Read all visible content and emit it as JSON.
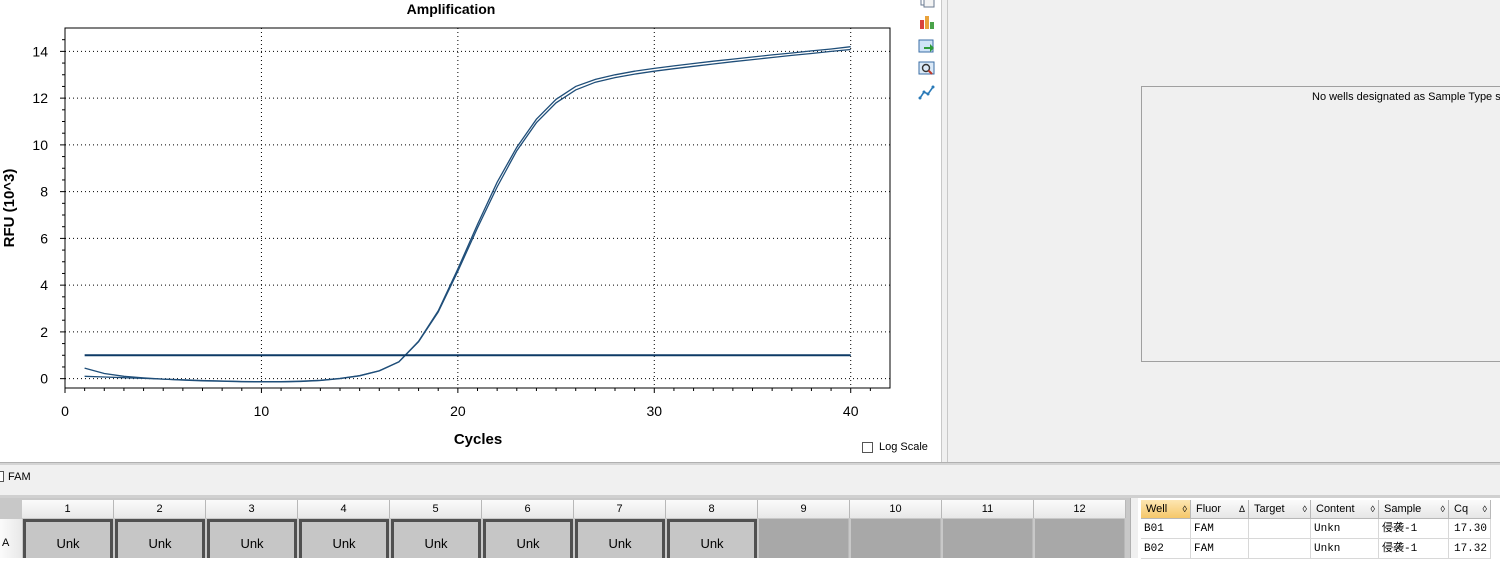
{
  "chart_data": {
    "type": "line",
    "title": "Amplification",
    "xlabel": "Cycles",
    "ylabel": "RFU (10^3)",
    "xlim": [
      0,
      42
    ],
    "ylim": [
      -0.4,
      15
    ],
    "xticks": [
      0,
      10,
      20,
      30,
      40
    ],
    "yticks": [
      0,
      2,
      4,
      6,
      8,
      10,
      12,
      14
    ],
    "grid": true,
    "threshold": 1.0,
    "x": [
      1,
      2,
      3,
      4,
      5,
      6,
      7,
      8,
      9,
      10,
      11,
      12,
      13,
      14,
      15,
      16,
      17,
      18,
      19,
      20,
      21,
      22,
      23,
      24,
      25,
      26,
      27,
      28,
      29,
      30,
      31,
      32,
      33,
      34,
      35,
      36,
      37,
      38,
      39,
      40
    ],
    "series": [
      {
        "values": [
          0.45,
          0.22,
          0.1,
          0.03,
          -0.02,
          -0.06,
          -0.09,
          -0.11,
          -0.13,
          -0.14,
          -0.14,
          -0.12,
          -0.08,
          0.0,
          0.12,
          0.33,
          0.72,
          1.6,
          2.9,
          4.7,
          6.6,
          8.4,
          9.9,
          11.1,
          11.95,
          12.5,
          12.8,
          13.0,
          13.15,
          13.27,
          13.38,
          13.48,
          13.58,
          13.67,
          13.76,
          13.85,
          13.93,
          14.02,
          14.1,
          14.2
        ]
      },
      {
        "values": [
          0.1,
          0.07,
          0.04,
          0.01,
          -0.02,
          -0.05,
          -0.08,
          -0.1,
          -0.12,
          -0.13,
          -0.13,
          -0.11,
          -0.07,
          0.01,
          0.13,
          0.34,
          0.72,
          1.58,
          2.85,
          4.6,
          6.45,
          8.2,
          9.75,
          10.95,
          11.8,
          12.35,
          12.68,
          12.88,
          13.03,
          13.15,
          13.26,
          13.36,
          13.46,
          13.56,
          13.65,
          13.74,
          13.83,
          13.91,
          14.0,
          14.08
        ]
      }
    ]
  },
  "toolbar_icons": [
    "copy-icon",
    "chart-settings-icon",
    "export-icon",
    "zoom-icon",
    "curve-fit-icon"
  ],
  "log_scale_label": "Log Scale",
  "sample_type_message": "No wells designated as Sample Type sta",
  "legend": {
    "fluor": "FAM"
  },
  "plate": {
    "columns": [
      "1",
      "2",
      "3",
      "4",
      "5",
      "6",
      "7",
      "8",
      "9",
      "10",
      "11",
      "12"
    ],
    "row_label": "A",
    "wells": [
      "Unk",
      "Unk",
      "Unk",
      "Unk",
      "Unk",
      "Unk",
      "Unk",
      "Unk",
      "",
      "",
      "",
      ""
    ]
  },
  "results": {
    "headers": [
      "Well",
      "Fluor",
      "Target",
      "Content",
      "Sample",
      "Cq"
    ],
    "sort_marks": [
      "◊",
      "Δ",
      "◊",
      "◊",
      "◊",
      "◊"
    ],
    "rows": [
      [
        "B01",
        "FAM",
        "",
        "Unkn",
        "侵袭-1",
        "17.30"
      ],
      [
        "B02",
        "FAM",
        "",
        "Unkn",
        "侵袭-1",
        "17.32"
      ]
    ]
  },
  "colors": {
    "curve": "#1f4e79",
    "threshold": "#0d3a66",
    "panel_bg": "#f0f0f0"
  }
}
